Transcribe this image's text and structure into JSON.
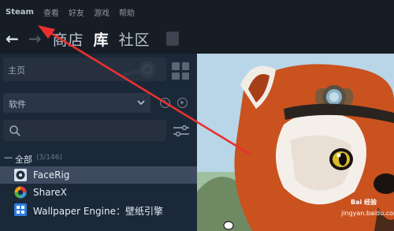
{
  "menu": [
    "Steam",
    "查看",
    "好友",
    "游戏",
    "帮助"
  ],
  "nav": {
    "links": [
      "商店",
      "库",
      "社区"
    ],
    "active_index": 1
  },
  "sidebar": {
    "home_label": "主页",
    "filter_label": "软件",
    "search_placeholder": "",
    "section_label": "全部",
    "section_count": "(3/146)",
    "games": [
      {
        "name": "FaceRig",
        "selected": true
      },
      {
        "name": "ShareX",
        "selected": false
      },
      {
        "name": "Wallpaper Engine：壁纸引擎",
        "selected": false
      }
    ]
  },
  "watermark": {
    "line1": "Bai 经验",
    "line2": "jingyan.baidu.com"
  },
  "colors": {
    "accent_red": "#e8312f",
    "selected_row": "#3d4a60"
  }
}
